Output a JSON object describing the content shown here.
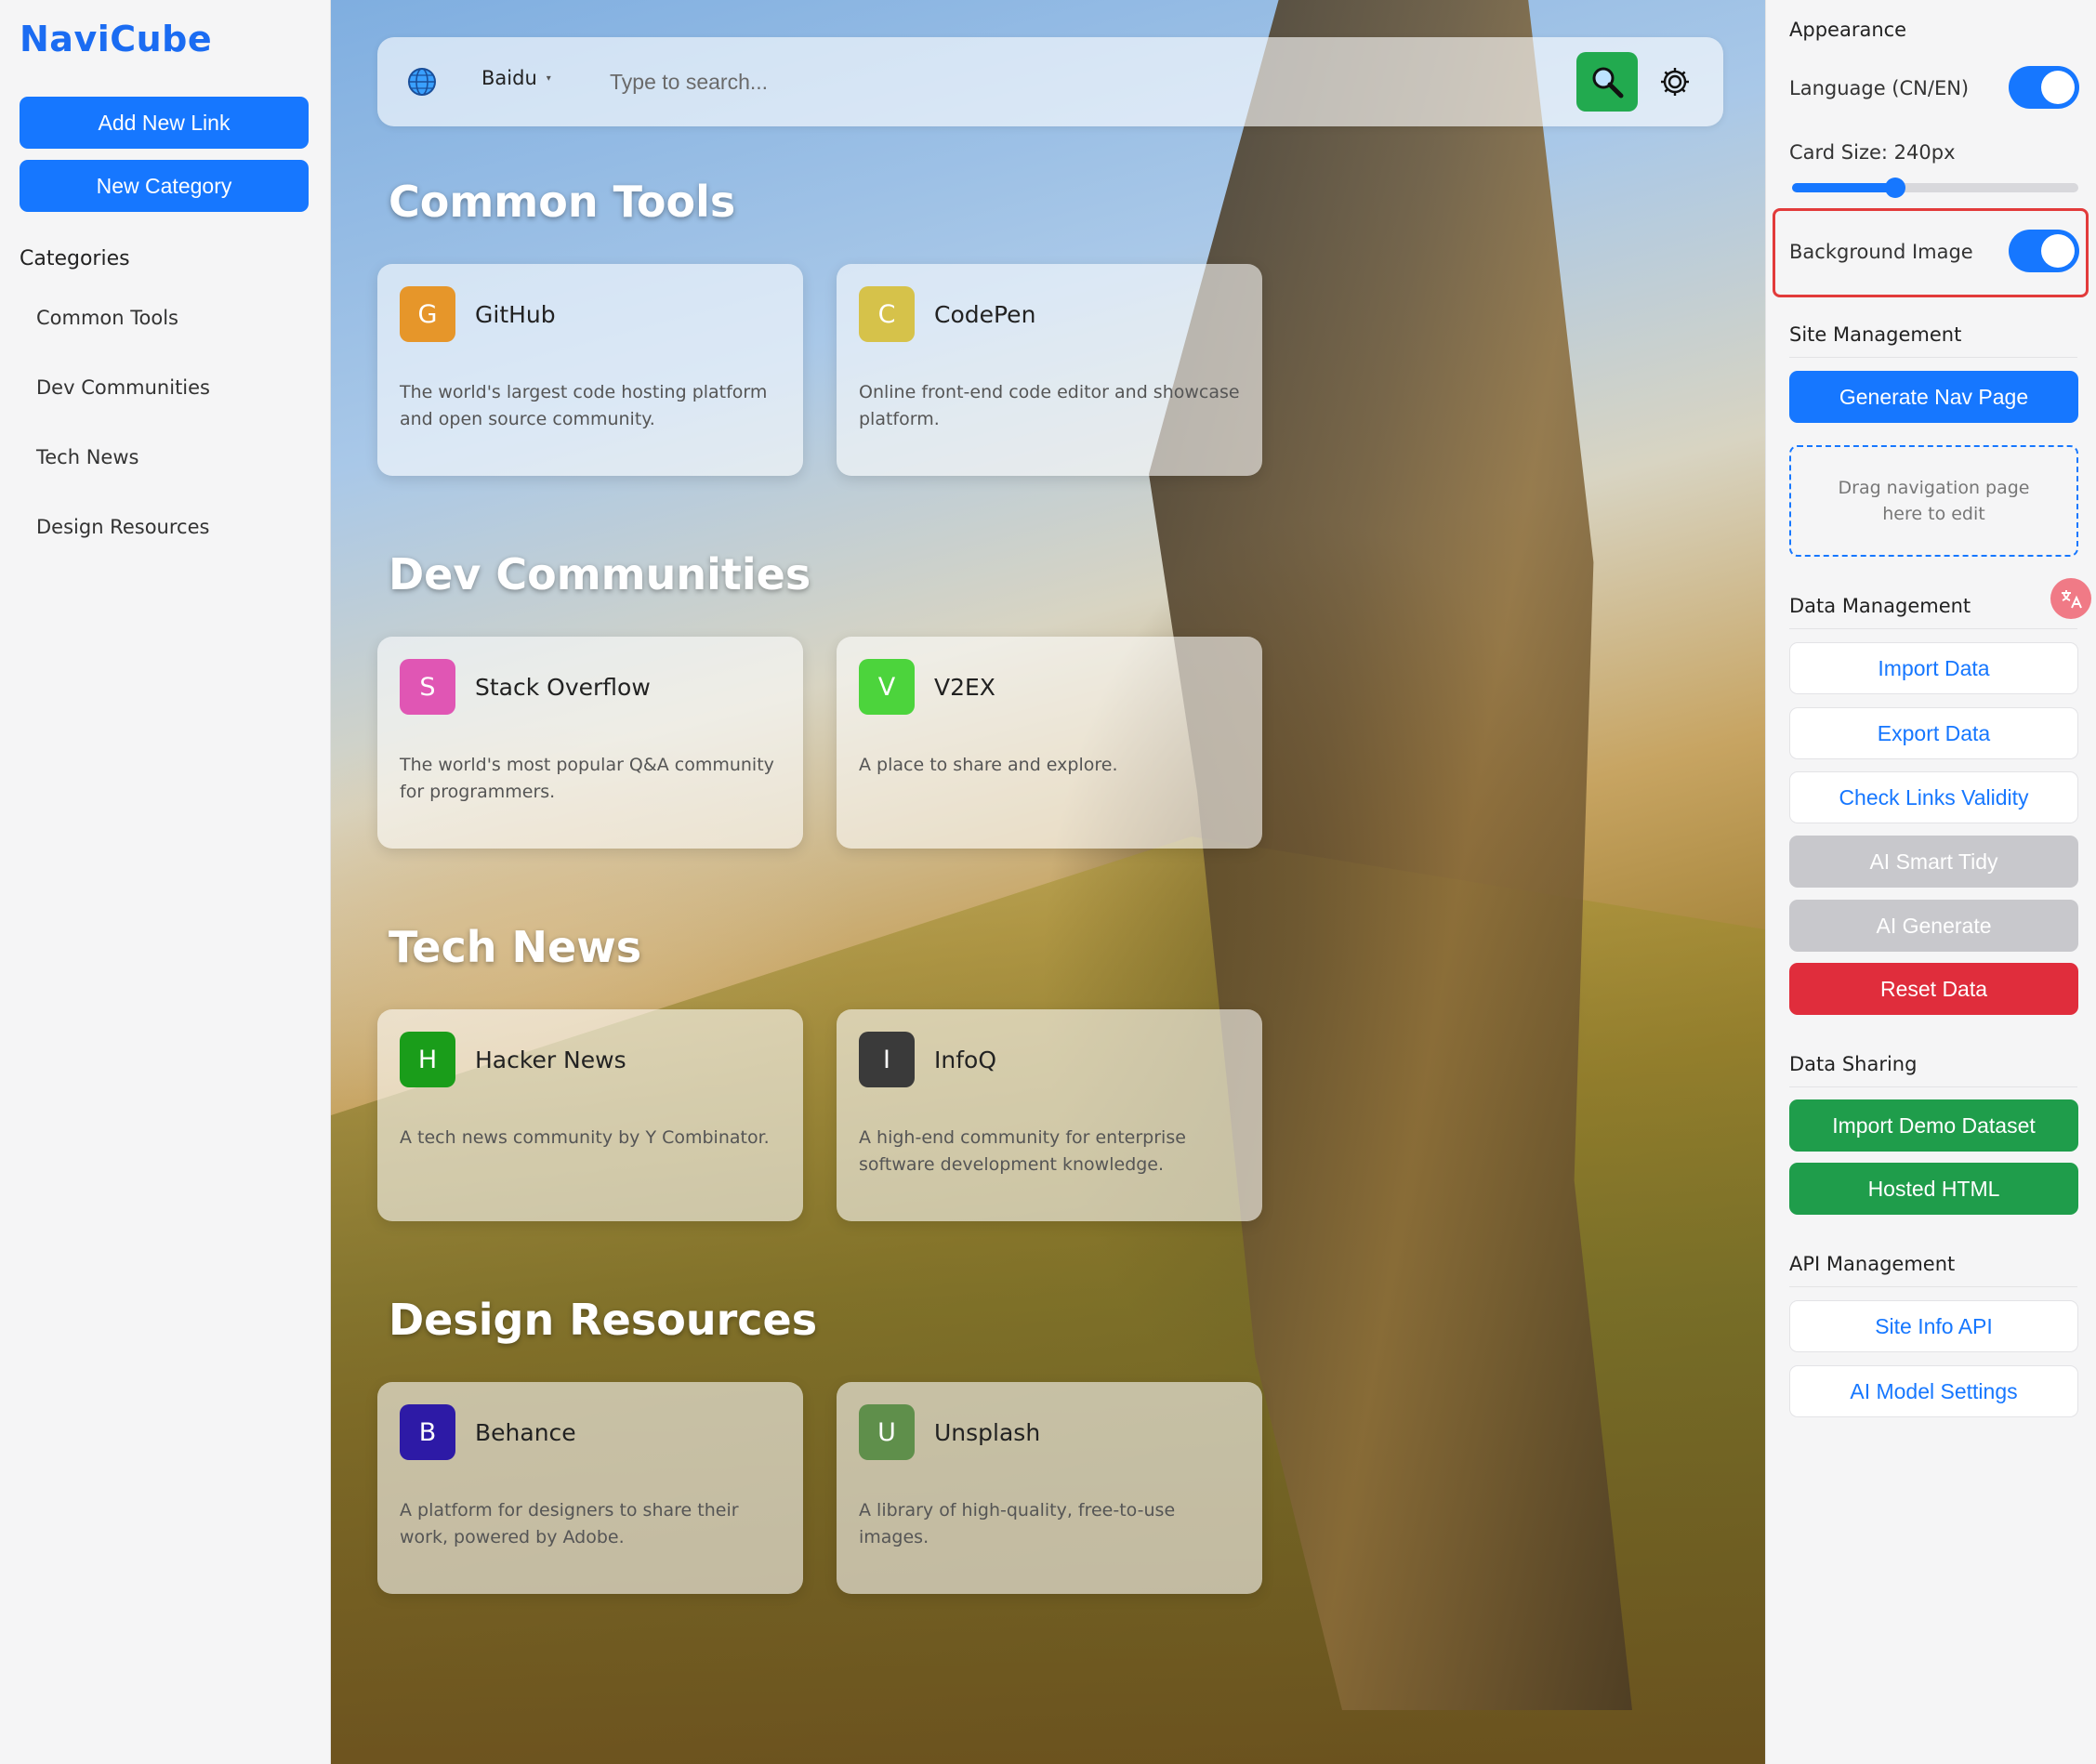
{
  "app": {
    "title": "NaviCube"
  },
  "sidebar": {
    "add_link_label": "Add New Link",
    "new_category_label": "New Category",
    "categories_heading": "Categories",
    "categories": [
      "Common Tools",
      "Dev Communities",
      "Tech News",
      "Design Resources"
    ]
  },
  "search": {
    "engine": "Baidu",
    "placeholder": "Type to search...",
    "value": ""
  },
  "sections": [
    {
      "title": "Common Tools",
      "cards": [
        {
          "letter": "G",
          "name": "GitHub",
          "desc": "The world's largest code hosting platform and open source community.",
          "color": "#e6962a"
        },
        {
          "letter": "C",
          "name": "CodePen",
          "desc": "Online front-end code editor and showcase platform.",
          "color": "#d6c24a"
        }
      ]
    },
    {
      "title": "Dev Communities",
      "cards": [
        {
          "letter": "S",
          "name": "Stack Overflow",
          "desc": "The world's most popular Q&A community for programmers.",
          "color": "#e056b4"
        },
        {
          "letter": "V",
          "name": "V2EX",
          "desc": "A place to share and explore.",
          "color": "#4cd43c"
        }
      ]
    },
    {
      "title": "Tech News",
      "cards": [
        {
          "letter": "H",
          "name": "Hacker News",
          "desc": "A tech news community by Y Combinator.",
          "color": "#1a9d1a"
        },
        {
          "letter": "I",
          "name": "InfoQ",
          "desc": "A high-end community for enterprise software development knowledge.",
          "color": "#3a3a3a"
        }
      ]
    },
    {
      "title": "Design Resources",
      "cards": [
        {
          "letter": "B",
          "name": "Behance",
          "desc": "A platform for designers to share their work, powered by Adobe.",
          "color": "#2d1aa6"
        },
        {
          "letter": "U",
          "name": "Unsplash",
          "desc": "A library of high-quality, free-to-use images.",
          "color": "#5f8f4b"
        }
      ]
    }
  ],
  "panel": {
    "appearance_heading": "Appearance",
    "language_label": "Language (CN/EN)",
    "language_enabled": true,
    "card_size_label": "Card Size: 240px",
    "card_size_fraction": 0.36,
    "background_label": "Background Image",
    "background_enabled": true,
    "site_heading": "Site Management",
    "generate_label": "Generate Nav Page",
    "drop_hint": "Drag navigation page here to edit",
    "data_heading": "Data Management",
    "import_label": "Import Data",
    "export_label": "Export Data",
    "check_label": "Check Links Validity",
    "ai_tidy_label": "AI Smart Tidy",
    "ai_generate_label": "AI Generate",
    "reset_label": "Reset Data",
    "sharing_heading": "Data Sharing",
    "demo_label": "Import Demo Dataset",
    "hosted_label": "Hosted HTML",
    "api_heading": "API Management",
    "site_api_label": "Site Info API",
    "ai_model_label": "AI Model Settings"
  },
  "colors": {
    "accent": "#1677ff",
    "danger": "#e02d3c",
    "success": "#1f9d4b",
    "disabled": "#c8c8cc"
  },
  "icons": {
    "globe": "globe-icon",
    "search": "magnifier-icon",
    "settings": "gear-icon",
    "translate": "translate-icon"
  }
}
